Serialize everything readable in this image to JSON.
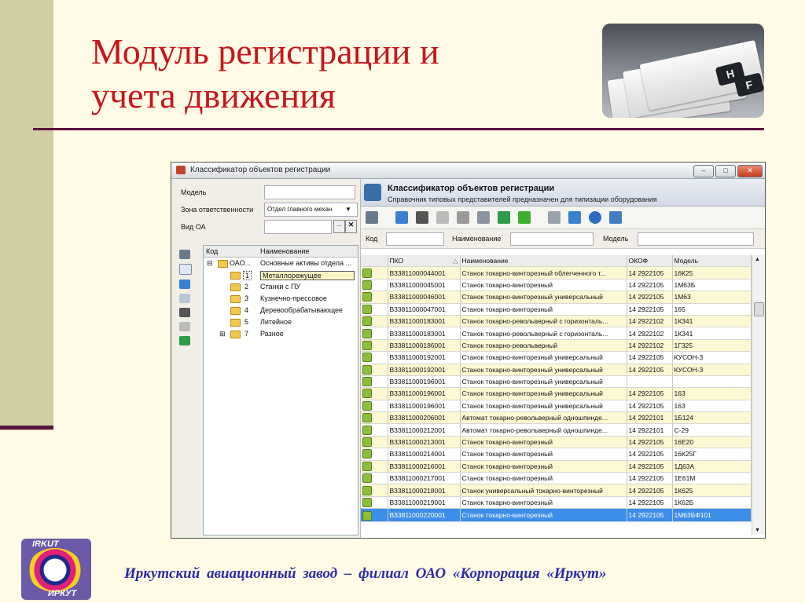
{
  "slide": {
    "title_line1": "Модуль регистрации и",
    "title_line2": "учета движения",
    "footer": "Иркутский  авиационный  завод  – филиал ОАО «Корпорация «Иркут»",
    "logo_top": "IRKUT",
    "logo_bottom": "ИРКУТ",
    "cards_tab1": "H",
    "cards_tab2": "F"
  },
  "window": {
    "title": "Классификатор объектов регистрации",
    "left": {
      "fields": [
        {
          "label": "Модель",
          "value": ""
        },
        {
          "label": "Зона ответственности",
          "value": "Отдел главного механ"
        },
        {
          "label": "Вид ОА",
          "value": ""
        }
      ],
      "tree_headers": {
        "code": "Код",
        "name": "Наименование"
      },
      "tree": [
        {
          "code": "ОАО...",
          "name": "Основные активы отдела ..."
        },
        {
          "code": "1",
          "name": "Металлорежущее"
        },
        {
          "code": "2",
          "name": "Станки с ПУ"
        },
        {
          "code": "3",
          "name": "Кузнечно-прессовое"
        },
        {
          "code": "4",
          "name": "Деревообрабатывающее"
        },
        {
          "code": "5",
          "name": "Литейное"
        },
        {
          "code": "7",
          "name": "Разное"
        }
      ]
    },
    "right": {
      "header_title": "Классификатор объектов регистрации",
      "header_subtitle": "Справочник типовых представителей предназначен для типизации оборудования",
      "filter": {
        "code": "Код",
        "name": "Наименование",
        "model": "Модель"
      },
      "columns": [
        "ПКО",
        "Наименование",
        "ОКОФ",
        "Модель"
      ],
      "rows": [
        [
          "В33811000044001",
          "Станок токарно-винторезный облегченного т...",
          "14 2922105",
          "16К25"
        ],
        [
          "В33811000045001",
          "Станок токарно-винторезный",
          "14 2922105",
          "1М63Б"
        ],
        [
          "В33811000046001",
          "Станок токарно-винторезный универсальный",
          "14 2922105",
          "1М63"
        ],
        [
          "В33811000047001",
          "Станок токарно-винторезный",
          "14 2922105",
          "165"
        ],
        [
          "В33811000183001",
          "Станок токарно-револьверный с горизонталь...",
          "14 2922102",
          "1К341"
        ],
        [
          "В33811000183001",
          "Станок токарно-револьверный с горизонталь...",
          "14 2922102",
          "1К341"
        ],
        [
          "В33811000186001",
          "Станок токарно-револьверный",
          "14 2922102",
          "1Г325"
        ],
        [
          "В33811000192001",
          "Станок токарно-винторезный универсальный",
          "14 2922105",
          "КУСОН-3"
        ],
        [
          "В33811000192001",
          "Станок токарно-винторезный универсальный",
          "14 2922105",
          "КУСОН-3"
        ],
        [
          "В33811000196001",
          "Станок токарно-винторезный универсальный",
          "",
          ""
        ],
        [
          "В33811000196001",
          "Станок токарно-винторезный универсальный",
          "14 2922105",
          "163"
        ],
        [
          "В33811000196001",
          "Станок токарно-винторезный универсальный",
          "14 2922105",
          "163"
        ],
        [
          "В33811000206001",
          "Автомат токарно-револьверный одношпинде...",
          "14 2922101",
          "1Б124"
        ],
        [
          "В33811000212001",
          "Автомат токарно-револьверный одношпинде...",
          "14 2922101",
          "С-29"
        ],
        [
          "В33811000213001",
          "Станок токарно-винторезный",
          "14 2922105",
          "16Е20"
        ],
        [
          "В33811000214001",
          "Станок токарно-винторезный",
          "14 2922105",
          "16К25Г"
        ],
        [
          "В33811000216001",
          "Станок токарно-винторезный",
          "14 2922105",
          "1Д63А"
        ],
        [
          "В33811000217001",
          "Станок токарно-винторезный",
          "14 2922105",
          "1Е61М"
        ],
        [
          "В33811000218001",
          "Станок универсальный токарно-винторезный",
          "14 2922105",
          "1К625"
        ],
        [
          "В33811000219001",
          "Станок токарно-винторезный",
          "14 2922105",
          "1К62Б"
        ],
        [
          "В33811000220001",
          "Станок токарно-винторезный",
          "14 2922105",
          "1М63БФ101"
        ]
      ],
      "selected_row_index": 20
    }
  }
}
